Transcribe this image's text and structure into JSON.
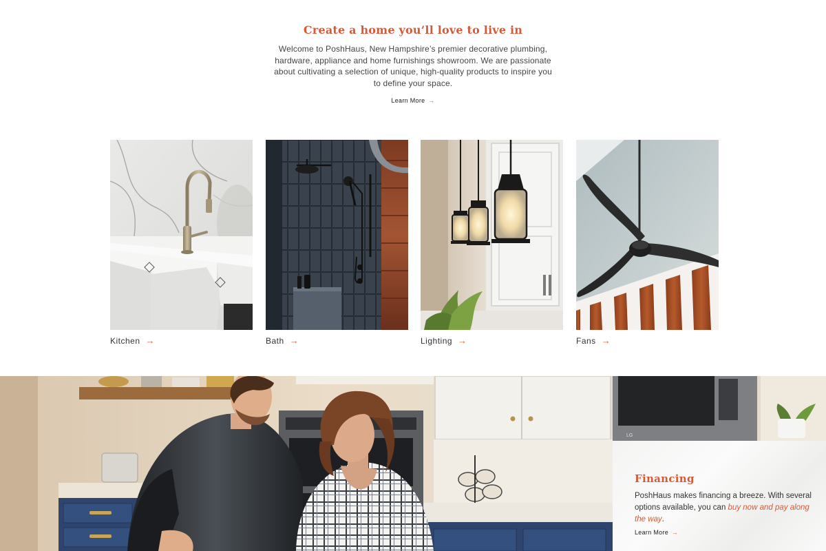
{
  "intro": {
    "heading": "Create a home you’ll love to live in",
    "body": "Welcome to PoshHaus, New Hampshire’s premier decorative plumbing, hardware, appliance and home furnishings showroom. We are passionate about cultivating a selection of unique, high-quality products to inspire you to define your space.",
    "link_label": "Learn More",
    "arrow": "→"
  },
  "categories": [
    {
      "label": "Kitchen",
      "arrow": "→"
    },
    {
      "label": "Bath",
      "arrow": "→"
    },
    {
      "label": "Lighting",
      "arrow": "→"
    },
    {
      "label": "Fans",
      "arrow": "→"
    }
  ],
  "financing": {
    "heading": "Financing",
    "body_prefix": "PoshHaus makes financing a breeze. With several options available, you can ",
    "body_link": "buy now and pay along the way",
    "body_suffix": ".",
    "link_label": "Learn More",
    "arrow": "→"
  },
  "hero": {
    "appliance_brand": "LG"
  },
  "colors": {
    "accent": "#d75a38"
  }
}
